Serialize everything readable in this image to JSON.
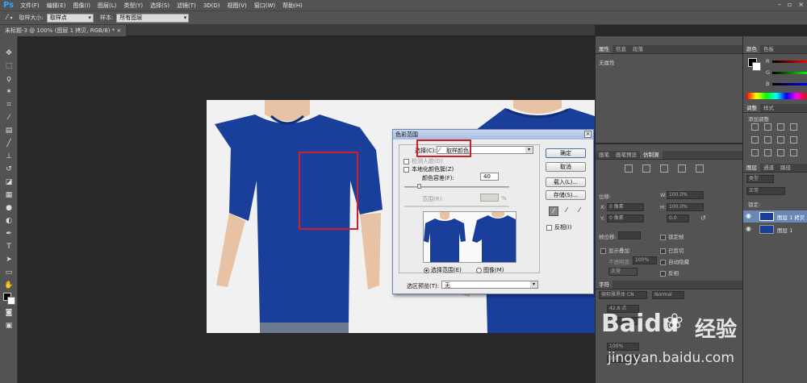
{
  "app": {
    "logo": "Ps"
  },
  "menu": [
    "文件(F)",
    "编辑(E)",
    "图像(I)",
    "图层(L)",
    "类型(Y)",
    "选择(S)",
    "滤镜(T)",
    "3D(D)",
    "视图(V)",
    "窗口(W)",
    "帮助(H)"
  ],
  "options": {
    "sample_size_label": "取样大小:",
    "sample_size_value": "取样点",
    "sample_label": "样本:",
    "sample_value": "所有图层"
  },
  "doc_tab": "未标题-3 @ 100% (图层 1 拷贝, RGB/8) *",
  "dialog": {
    "title": "色彩范围",
    "select_label": "选择(C):",
    "select_value": "取样颜色",
    "detect_faces": "检测人脸(D)",
    "localized": "本地化颜色簇(Z)",
    "fuzziness_label": "颜色容差(F):",
    "fuzziness_value": "40",
    "range_label": "范围(R):",
    "range_unit": "%",
    "radio_selection": "选择范围(E)",
    "radio_image": "图像(M)",
    "preview_label": "选区预览(T):",
    "preview_value": "无",
    "btn_ok": "确定",
    "btn_cancel": "取消",
    "btn_load": "载入(L)...",
    "btn_save": "存储(S)...",
    "invert": "反相(I)"
  },
  "panels": {
    "props_tabs": [
      "属性",
      "信息",
      "段落"
    ],
    "props_text": "无属性",
    "color_tabs": [
      "颜色",
      "色板"
    ],
    "channels": [
      "R",
      "G",
      "B"
    ],
    "adjust_tabs": [
      "调整",
      "样式"
    ],
    "adjust_add": "添加调整",
    "align_tabs": [
      "画笔",
      "画笔预设",
      "仿制源"
    ],
    "offset_label": "位移:",
    "x_label": "X:",
    "y_label": "Y:",
    "w_label": "W:",
    "h_label": "H:",
    "pct_100": "100.0%",
    "deg_0": "0.0度",
    "px_0_x": "0 像素",
    "px_0_y": "0 像素",
    "angle_val": "0.0",
    "frame_offset": "帧位移:",
    "lock_frame": "锁定帧",
    "show_overlay": "显示叠加",
    "opacity_label": "不透明度:",
    "opacity_value": "100%",
    "clipped": "已剪切",
    "auto_hide": "自动隐藏",
    "invert_label": "反相",
    "blend_normal": "正常",
    "layers_tabs": [
      "图层",
      "通道",
      "路径"
    ],
    "layers_kind": "类型",
    "layers_mode": "正常",
    "lock_label": "锁定:",
    "layers": [
      "图层 1 拷贝",
      "图层 1"
    ],
    "char_tab": "字符",
    "font_name": "微软雅黑体 CN",
    "font_style": "Normal",
    "char_vals": [
      "42.8 点",
      "0",
      "100%",
      "0 点"
    ]
  },
  "watermark": {
    "brand": "Baidu",
    "brand2": "经验",
    "url": "jingyan.baidu.com"
  },
  "colors": {
    "panel": "#535353",
    "canvas": "#282828",
    "shirt": "#1a3f9a",
    "highlight": "#cc1f2a",
    "accent": "#31a8ff"
  }
}
